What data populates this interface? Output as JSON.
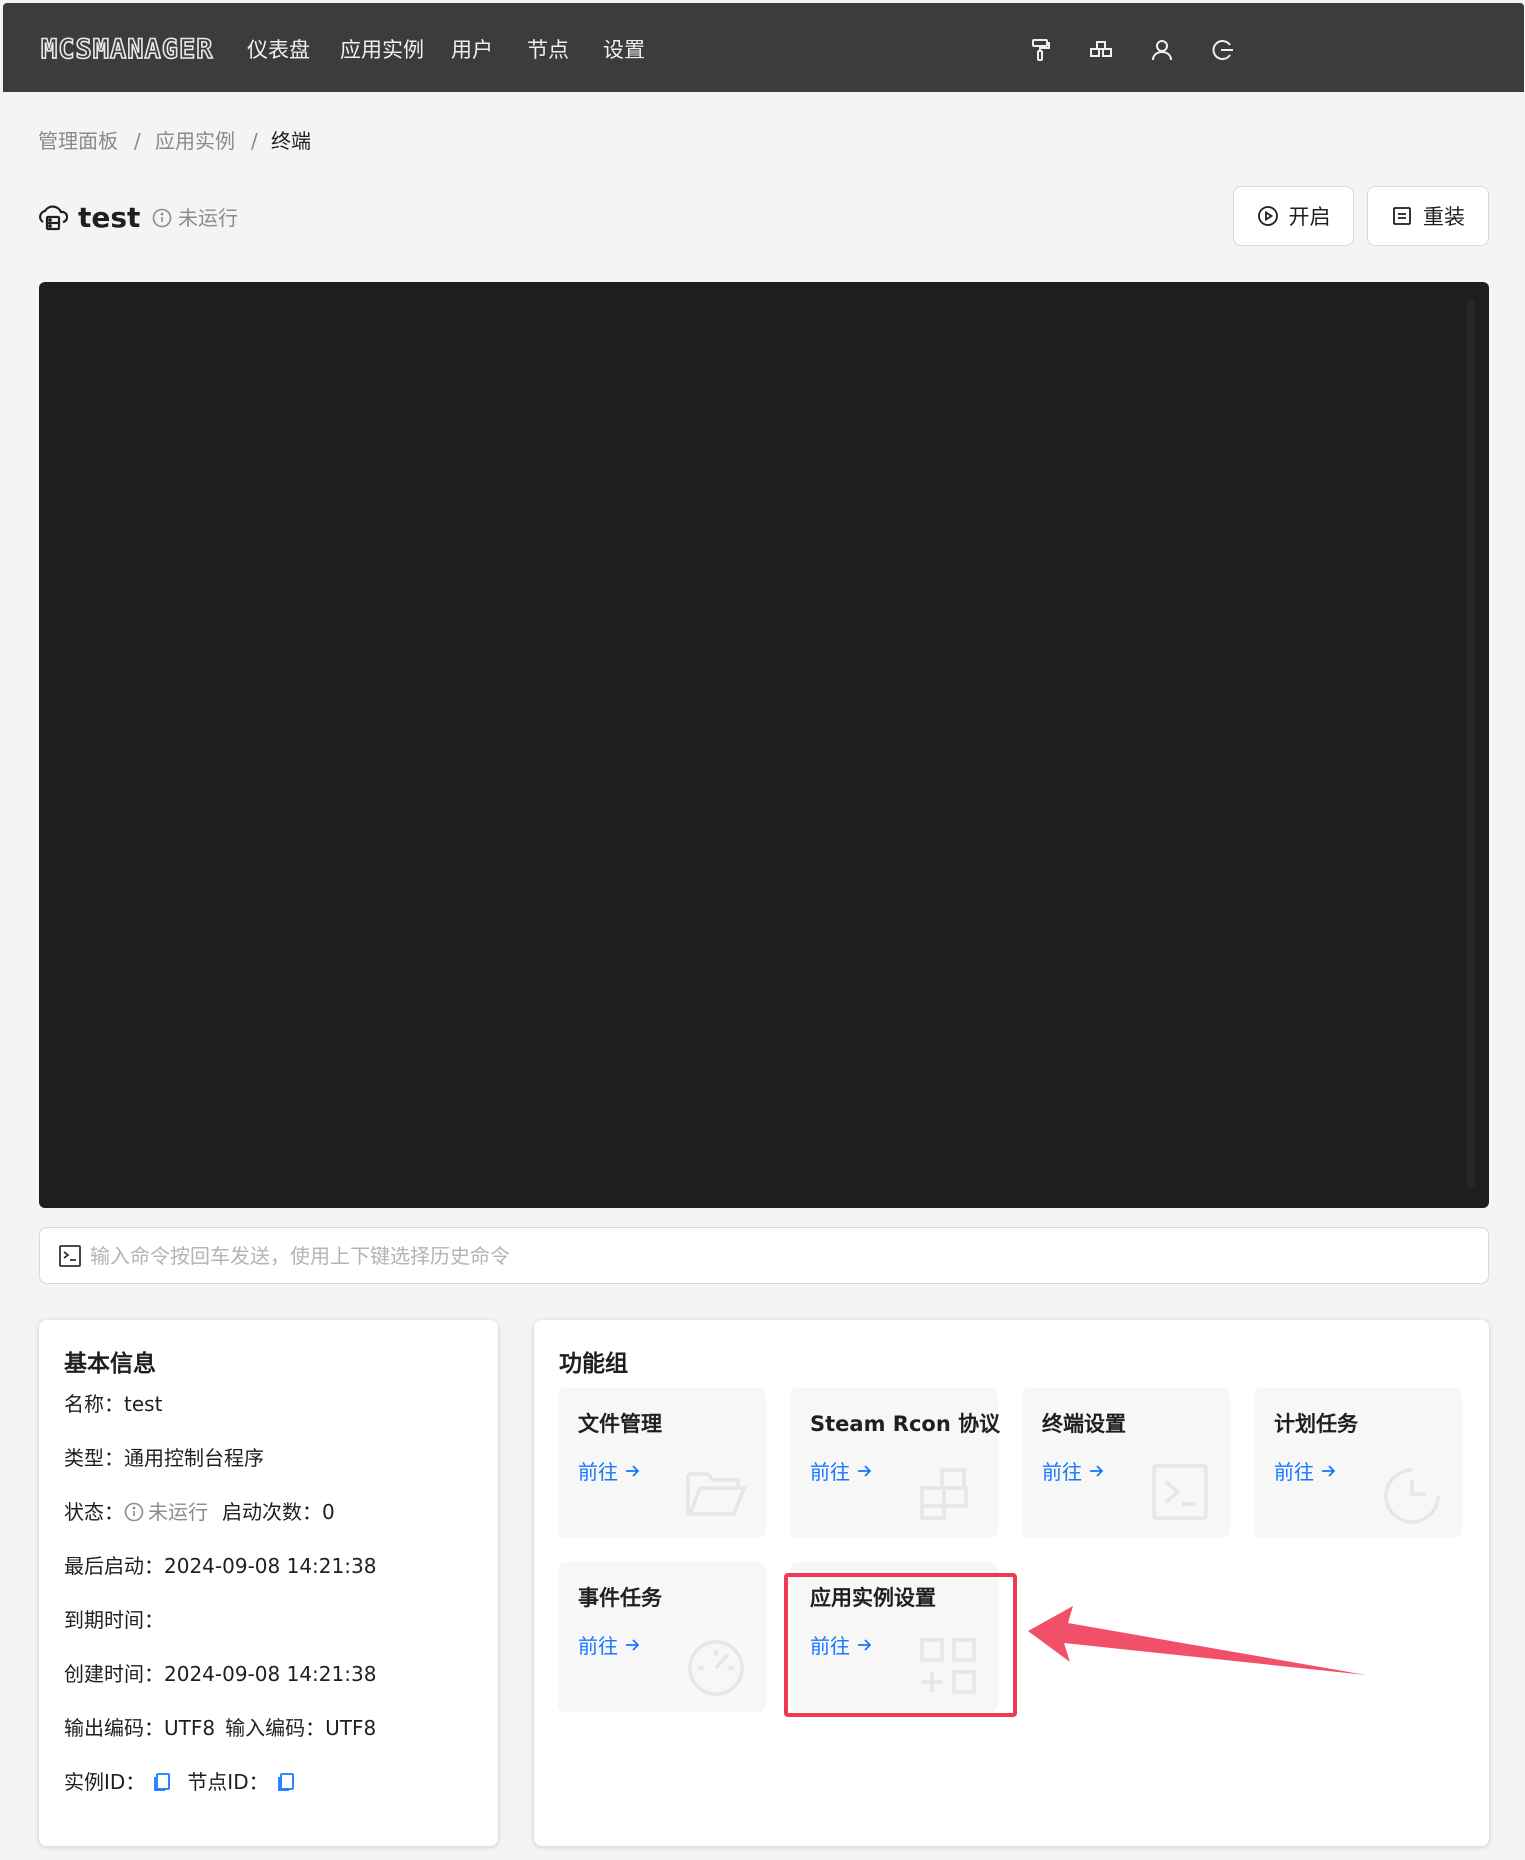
{
  "topbar": {
    "logo": "MCSMANAGER",
    "nav": [
      "仪表盘",
      "应用实例",
      "用户",
      "节点",
      "设置"
    ],
    "icons": [
      "paint-roller-icon",
      "cluster-icon",
      "user-icon",
      "logout-icon"
    ]
  },
  "breadcrumb": [
    "管理面板",
    "/",
    "应用实例",
    "/",
    "终端"
  ],
  "instance": {
    "name": "test",
    "status": "未运行",
    "start_button": "开启",
    "reinstall_button": "重装"
  },
  "command": {
    "placeholder": "输入命令按回车发送，使用上下键选择历史命令"
  },
  "basic_info": {
    "title": "基本信息",
    "name_label": "名称：",
    "name_value": "test",
    "type_label": "类型：",
    "type_value": "通用控制台程序",
    "status_label": "状态：",
    "status_value": "未运行",
    "start_count_label": "启动次数：",
    "start_count_value": "0",
    "last_start_label": "最后启动：",
    "last_start_value": "2024-09-08 14:21:38",
    "expire_label": "到期时间：",
    "created_label": "创建时间：",
    "created_value": "2024-09-08 14:21:38",
    "output_encoding_label": "输出编码：",
    "output_encoding_value": "UTF8",
    "input_encoding_label": "输入编码：",
    "input_encoding_value": "UTF8",
    "instance_id_label": "实例ID：",
    "node_id_label": "节点ID："
  },
  "features": {
    "title": "功能组",
    "link_label": "前往",
    "items": [
      {
        "title": "文件管理",
        "icon": "folder-icon"
      },
      {
        "title": "Steam Rcon 协议",
        "icon": "blocks-icon"
      },
      {
        "title": "终端设置",
        "icon": "terminal-icon"
      },
      {
        "title": "计划任务",
        "icon": "clock-icon"
      },
      {
        "title": "事件任务",
        "icon": "dashboard-icon"
      },
      {
        "title": "应用实例设置",
        "icon": "appstore-add-icon"
      }
    ]
  },
  "colors": {
    "topbar": "#3c3c3c",
    "link": "#1677ff",
    "highlight": "#f03a55",
    "terminal": "#1e1e1e"
  }
}
